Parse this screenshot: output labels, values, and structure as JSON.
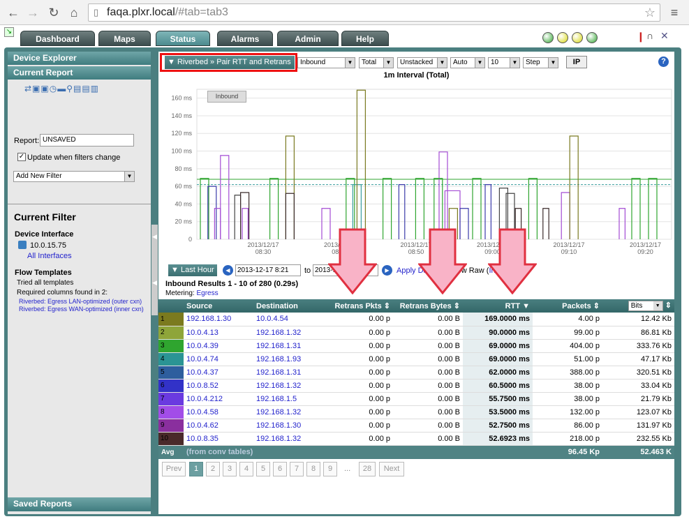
{
  "browser": {
    "url_host": "faqa.plxr.local",
    "url_path": "/#tab=tab3",
    "back_icon": "back-arrow-icon",
    "forward_icon": "forward-arrow-icon",
    "reload_icon": "reload-icon",
    "home_icon": "home-icon"
  },
  "tabs": [
    "Dashboard",
    "Maps",
    "Status",
    "Alarms",
    "Admin",
    "Help"
  ],
  "active_tab": "Status",
  "status_lights": [
    "#2fa52f",
    "#d8d810",
    "#d8d810",
    "#2fa52f"
  ],
  "left": {
    "device_explorer": "Device Explorer",
    "current_report": "Current Report",
    "report_label": "Report:",
    "report_value": "UNSAVED",
    "update_label": "Update when filters change",
    "add_filter": "Add New Filter",
    "current_filter": "Current Filter",
    "device_interface_label": "Device Interface",
    "device_ip": "10.0.15.75",
    "all_interfaces": "All Interfaces",
    "flow_templates": "Flow Templates",
    "tried_all": "Tried all templates",
    "required_columns": "Required columns found in 2:",
    "template_1": "Riverbed: Egress LAN-optimized (outer cxn)",
    "template_2": "Riverbed: Egress WAN-optimized (inner cxn)",
    "saved_reports": "Saved Reports"
  },
  "toolbar": {
    "report_title": "▼ Riverbed » Pair RTT and Retrans",
    "direction": "Inbound",
    "total": "Total",
    "stacked": "Unstacked",
    "auto": "Auto",
    "limit": "10",
    "step": "Step",
    "ip_button": "IP",
    "help": "?"
  },
  "chart_data": {
    "type": "line",
    "title": "1m Interval (Total)",
    "legend": "Inbound",
    "ylim": [
      0,
      170
    ],
    "yticks": [
      "0",
      "20 ms",
      "40 ms",
      "60 ms",
      "80 ms",
      "100 ms",
      "120 ms",
      "140 ms",
      "160 ms"
    ],
    "ytick_values": [
      0,
      20,
      40,
      60,
      80,
      100,
      120,
      140,
      160
    ],
    "xticks": [
      {
        "date": "2013/12/17",
        "time": "08:30"
      },
      {
        "date": "2013/12/17",
        "time": "08:40"
      },
      {
        "date": "2013/12/17",
        "time": "08:50"
      },
      {
        "date": "2013/12/17",
        "time": "09:00"
      },
      {
        "date": "2013/12/17",
        "time": "09:10"
      },
      {
        "date": "2013/12/17",
        "time": "09:20"
      }
    ],
    "avg_line": 62,
    "pulses": [
      {
        "x": 0,
        "w": 10,
        "v": 69,
        "c": "#2fa52f"
      },
      {
        "x": 9,
        "w": 10,
        "v": 60,
        "c": "#3b3baa"
      },
      {
        "x": 17,
        "w": 7,
        "v": 35,
        "c": "#a34bd4"
      },
      {
        "x": 24,
        "w": 10,
        "v": 95,
        "c": "#a34bd4"
      },
      {
        "x": 41,
        "w": 7,
        "v": 50,
        "c": "#444"
      },
      {
        "x": 48,
        "w": 10,
        "v": 53,
        "c": "#3a2a2a"
      },
      {
        "x": 50,
        "w": 7,
        "v": 35,
        "c": "#a34bd4"
      },
      {
        "x": 83,
        "w": 10,
        "v": 69,
        "c": "#2fa52f"
      },
      {
        "x": 102,
        "w": 10,
        "v": 117,
        "c": "#7a7a20"
      },
      {
        "x": 102,
        "w": 10,
        "v": 52,
        "c": "#3a2a2a"
      },
      {
        "x": 145,
        "w": 10,
        "v": 35,
        "c": "#a34bd4"
      },
      {
        "x": 174,
        "w": 10,
        "v": 69,
        "c": "#2fa52f"
      },
      {
        "x": 182,
        "w": 10,
        "v": 62,
        "c": "#3a9e9e"
      },
      {
        "x": 187,
        "w": 10,
        "v": 169,
        "c": "#7a7a20"
      },
      {
        "x": 218,
        "w": 10,
        "v": 69,
        "c": "#2fa52f"
      },
      {
        "x": 237,
        "w": 7,
        "v": 62,
        "c": "#3b3baa"
      },
      {
        "x": 257,
        "w": 10,
        "v": 69,
        "c": "#2fa52f"
      },
      {
        "x": 285,
        "w": 10,
        "v": 99,
        "c": "#a34bd4"
      },
      {
        "x": 279,
        "w": 10,
        "v": 69,
        "c": "#2fa52f"
      },
      {
        "x": 292,
        "w": 18,
        "v": 55,
        "c": "#a34bd4"
      },
      {
        "x": 297,
        "w": 10,
        "v": 35,
        "c": "#7a7a20"
      },
      {
        "x": 310,
        "w": 10,
        "v": 35,
        "c": "#3b3baa"
      },
      {
        "x": 325,
        "w": 10,
        "v": 69,
        "c": "#2fa52f"
      },
      {
        "x": 340,
        "w": 7,
        "v": 62,
        "c": "#3b3baa"
      },
      {
        "x": 357,
        "w": 10,
        "v": 58,
        "c": "#444"
      },
      {
        "x": 365,
        "w": 10,
        "v": 52,
        "c": "#444"
      },
      {
        "x": 376,
        "w": 7,
        "v": 35,
        "c": "#3a2a2a"
      },
      {
        "x": 392,
        "w": 10,
        "v": 69,
        "c": "#2fa52f"
      },
      {
        "x": 409,
        "w": 7,
        "v": 35,
        "c": "#3a2a2a"
      },
      {
        "x": 431,
        "w": 10,
        "v": 53,
        "c": "#a34bd4"
      },
      {
        "x": 441,
        "w": 10,
        "v": 117,
        "c": "#7a7a20"
      },
      {
        "x": 500,
        "w": 7,
        "v": 35,
        "c": "#a34bd4"
      },
      {
        "x": 515,
        "w": 10,
        "v": 69,
        "c": "#2fa52f"
      },
      {
        "x": 535,
        "w": 10,
        "v": 69,
        "c": "#2fa52f"
      }
    ]
  },
  "date_bar": {
    "last_hour": "Last Hour",
    "from": "2013-12-17 8:21",
    "to_label": "to",
    "to": "2013-12-17 9:21",
    "apply": "Apply Date",
    "view_raw_prefix": "View Raw (",
    "view_raw_link": "Inbound",
    "view_raw_suffix": " )"
  },
  "results_title": "Inbound Results 1 - 10 of 280 (0.29s)",
  "metering_label": "Metering:",
  "metering_value": "Egress",
  "columns": [
    "Source",
    "Destination",
    "Retrans Pkts",
    "Retrans Bytes",
    "RTT",
    "Packets",
    "Bits"
  ],
  "rows": [
    {
      "n": "1",
      "color": "#7b7a1f",
      "src": "192.168.1.30",
      "dst": "10.0.4.54",
      "rp": "0.00 p",
      "rb": "0.00 B",
      "rtt": "169.0000 ms",
      "pk": "4.00 p",
      "bits": "12.42 Kb"
    },
    {
      "n": "2",
      "color": "#8ea53a",
      "src": "10.0.4.13",
      "dst": "192.168.1.32",
      "rp": "0.00 p",
      "rb": "0.00 B",
      "rtt": "90.0000 ms",
      "pk": "99.00 p",
      "bits": "86.81 Kb"
    },
    {
      "n": "3",
      "color": "#2fa52f",
      "src": "10.0.4.39",
      "dst": "192.168.1.31",
      "rp": "0.00 p",
      "rb": "0.00 B",
      "rtt": "69.0000 ms",
      "pk": "404.00 p",
      "bits": "333.76 Kb"
    },
    {
      "n": "4",
      "color": "#2b9494",
      "src": "10.0.4.74",
      "dst": "192.168.1.93",
      "rp": "0.00 p",
      "rb": "0.00 B",
      "rtt": "69.0000 ms",
      "pk": "51.00 p",
      "bits": "47.17 Kb"
    },
    {
      "n": "5",
      "color": "#2e5e9e",
      "src": "10.0.4.37",
      "dst": "192.168.1.31",
      "rp": "0.00 p",
      "rb": "0.00 B",
      "rtt": "62.0000 ms",
      "pk": "388.00 p",
      "bits": "320.51 Kb"
    },
    {
      "n": "6",
      "color": "#3232c8",
      "src": "10.0.8.52",
      "dst": "192.168.1.32",
      "rp": "0.00 p",
      "rb": "0.00 B",
      "rtt": "60.5000 ms",
      "pk": "38.00 p",
      "bits": "33.04 Kb"
    },
    {
      "n": "7",
      "color": "#6a3ae0",
      "src": "10.0.4.212",
      "dst": "192.168.1.5",
      "rp": "0.00 p",
      "rb": "0.00 B",
      "rtt": "55.7500 ms",
      "pk": "38.00 p",
      "bits": "21.79 Kb"
    },
    {
      "n": "8",
      "color": "#a24de8",
      "src": "10.0.4.58",
      "dst": "192.168.1.32",
      "rp": "0.00 p",
      "rb": "0.00 B",
      "rtt": "53.5000 ms",
      "pk": "132.00 p",
      "bits": "123.07 Kb"
    },
    {
      "n": "9",
      "color": "#8a2f9e",
      "src": "10.0.4.62",
      "dst": "192.168.1.30",
      "rp": "0.00 p",
      "rb": "0.00 B",
      "rtt": "52.7500 ms",
      "pk": "86.00 p",
      "bits": "131.97 Kb"
    },
    {
      "n": "10",
      "color": "#4a2a2a",
      "src": "10.0.8.35",
      "dst": "192.168.1.32",
      "rp": "0.00 p",
      "rb": "0.00 B",
      "rtt": "52.6923 ms",
      "pk": "218.00 p",
      "bits": "232.55 Kb"
    }
  ],
  "avg": {
    "label": "Avg",
    "note": "(from conv tables)",
    "packets": "96.45 Kp",
    "bits": "52.463 K"
  },
  "pager": {
    "prev": "Prev",
    "pages": [
      "1",
      "2",
      "3",
      "4",
      "5",
      "6",
      "7",
      "8",
      "9"
    ],
    "ellipsis": "...",
    "last": "28",
    "next": "Next"
  }
}
